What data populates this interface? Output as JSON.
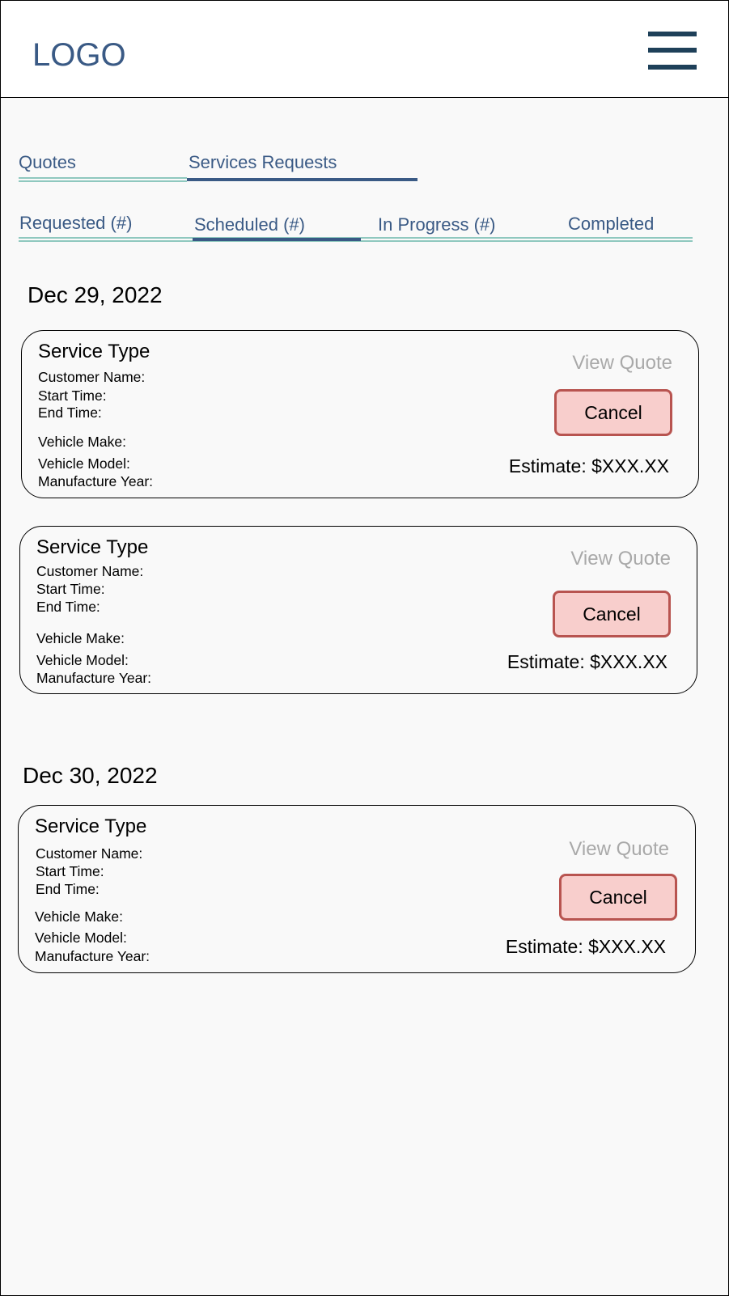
{
  "header": {
    "logo": "LOGO"
  },
  "main_tabs": [
    {
      "label": "Quotes",
      "active": false
    },
    {
      "label": "Services Requests",
      "active": true
    }
  ],
  "sub_tabs": [
    {
      "label": "Requested (#)",
      "active": false
    },
    {
      "label": "Scheduled (#)",
      "active": true
    },
    {
      "label": "In Progress (#)",
      "active": false
    },
    {
      "label": "Completed",
      "active": false
    }
  ],
  "groups": [
    {
      "date": "Dec 29, 2022",
      "cards": [
        {
          "service_type": "Service Type",
          "customer_name_label": "Customer Name:",
          "start_time_label": "Start Time:",
          "end_time_label": "End Time:",
          "vehicle_make_label": "Vehicle Make:",
          "vehicle_model_label": "Vehicle Model:",
          "manufacture_year_label": "Manufacture Year:",
          "view_quote_label": "View Quote",
          "cancel_label": "Cancel",
          "estimate": "Estimate: $XXX.XX"
        },
        {
          "service_type": "Service Type",
          "customer_name_label": "Customer Name:",
          "start_time_label": "Start Time:",
          "end_time_label": "End Time:",
          "vehicle_make_label": "Vehicle Make:",
          "vehicle_model_label": "Vehicle Model:",
          "manufacture_year_label": "Manufacture Year:",
          "view_quote_label": "View Quote",
          "cancel_label": "Cancel",
          "estimate": "Estimate: $XXX.XX"
        }
      ]
    },
    {
      "date": "Dec 30, 2022",
      "cards": [
        {
          "service_type": "Service Type",
          "customer_name_label": "Customer Name:",
          "start_time_label": "Start Time:",
          "end_time_label": "End Time:",
          "vehicle_make_label": "Vehicle Make:",
          "vehicle_model_label": "Vehicle Model:",
          "manufacture_year_label": "Manufacture Year:",
          "view_quote_label": "View Quote",
          "cancel_label": "Cancel",
          "estimate": "Estimate: $XXX.XX"
        }
      ]
    }
  ],
  "colors": {
    "accent": "#3a5a85",
    "tab_underline": "#8fc8bf",
    "cancel_fill": "#f8cecc",
    "cancel_border": "#b85450",
    "muted_link": "#a9a9a9",
    "menu_icon": "#1e4059"
  },
  "icons": {
    "menu": "hamburger-menu-icon"
  }
}
